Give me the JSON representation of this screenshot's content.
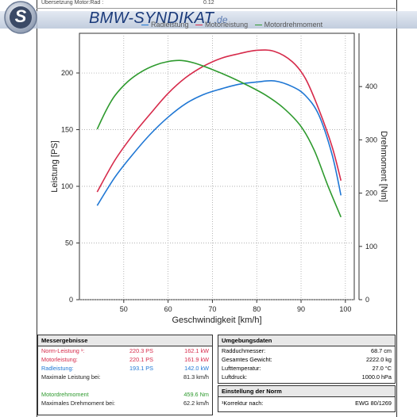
{
  "header": {
    "top_label": "Übersetzung Motor:Rad :",
    "top_value": "0.12",
    "site_name": "BMW-SYNDIKAT",
    "site_suffix": ".de",
    "logo_letter": "S"
  },
  "legend": [
    {
      "label": "Radleistung",
      "color": "#1f77d4"
    },
    {
      "label": "Motorleistung",
      "color": "#d62a4a"
    },
    {
      "label": "Motordrehmoment",
      "color": "#2e9a2e"
    }
  ],
  "chart_data": {
    "type": "line",
    "xlabel": "Geschwindigkeit [km/h]",
    "ylabel": "Leistung [PS]",
    "y2label": "Drehmoment [Nm]",
    "xlim": [
      40,
      102
    ],
    "ylim": [
      0,
      235
    ],
    "y2lim": [
      0,
      500
    ],
    "xticks": [
      50,
      60,
      70,
      80,
      90,
      100
    ],
    "yticks": [
      0,
      50,
      100,
      150,
      200
    ],
    "y2ticks": [
      0,
      100,
      200,
      300,
      400
    ],
    "grid": true,
    "series": [
      {
        "name": "Radleistung",
        "axis": "left",
        "color": "#1f77d4",
        "x": [
          44,
          48,
          52,
          56,
          60,
          64,
          68,
          72,
          76,
          80,
          84,
          88,
          91,
          94,
          97,
          99
        ],
        "y": [
          83,
          108,
          128,
          146,
          161,
          173,
          181,
          186,
          190,
          192,
          193,
          188,
          180,
          163,
          128,
          92
        ]
      },
      {
        "name": "Motorleistung",
        "axis": "left",
        "color": "#d62a4a",
        "x": [
          44,
          48,
          52,
          56,
          60,
          64,
          68,
          72,
          76,
          80,
          84,
          88,
          91,
          94,
          97,
          99
        ],
        "y": [
          95,
          123,
          145,
          164,
          182,
          196,
          206,
          213,
          217,
          220,
          219,
          210,
          195,
          168,
          135,
          105
        ]
      },
      {
        "name": "Motordrehmoment",
        "axis": "right",
        "color": "#2e9a2e",
        "x": [
          44,
          46,
          48,
          51,
          54,
          57,
          60,
          63,
          66,
          70,
          74,
          78,
          82,
          86,
          90,
          93,
          96,
          99
        ],
        "y": [
          320,
          355,
          383,
          410,
          428,
          440,
          447,
          449,
          444,
          432,
          418,
          402,
          384,
          360,
          325,
          280,
          215,
          155
        ]
      }
    ]
  },
  "results": {
    "title": "Messergebnisse",
    "rows": [
      {
        "label": "Norm-Leistung ¹:",
        "v1": "220.3 PS",
        "v2": "162.1 kW",
        "color": "#d62a4a"
      },
      {
        "label": "Motorleistung:",
        "v1": "220.1 PS",
        "v2": "161.9 kW",
        "color": "#d62a4a"
      },
      {
        "label": "Radleistung:",
        "v1": "193.1 PS",
        "v2": "142.0 kW",
        "color": "#1f77d4"
      },
      {
        "label": "Maximale Leistung bei:",
        "v1": "",
        "v2": "81.3 km/h",
        "color": "#222222"
      },
      {
        "label": "",
        "v1": "",
        "v2": "",
        "color": "#222222"
      },
      {
        "label": "Motordrehmoment",
        "v1": "",
        "v2": "459.6 Nm",
        "color": "#2e9a2e"
      },
      {
        "label": "Maximales Drehmoment bei:",
        "v1": "",
        "v2": "62.2 km/h",
        "color": "#222222"
      }
    ]
  },
  "environment": {
    "title": "Umgebungsdaten",
    "rows": [
      {
        "label": "Radduchmesser:",
        "value": "68.7 cm"
      },
      {
        "label": "Gesamtes Gewicht:",
        "value": "2222.0 kg"
      },
      {
        "label": "Lufttemperatur:",
        "value": "27.0 °C"
      },
      {
        "label": "Luftdruck:",
        "value": "1000.0 hPa"
      }
    ]
  },
  "norm": {
    "title": "Einstellung der Norm",
    "label": "¹Korrektur nach:",
    "value": "EWG 80/1269"
  }
}
